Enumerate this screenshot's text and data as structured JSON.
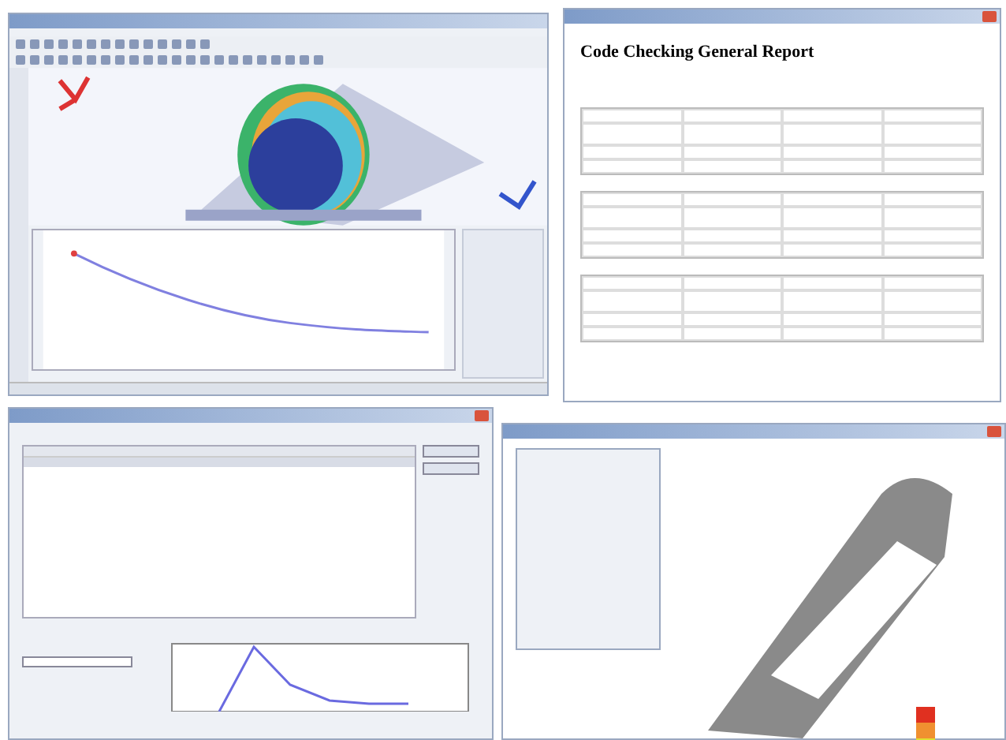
{
  "report": {
    "heading": "Code Checking General Report"
  }
}
